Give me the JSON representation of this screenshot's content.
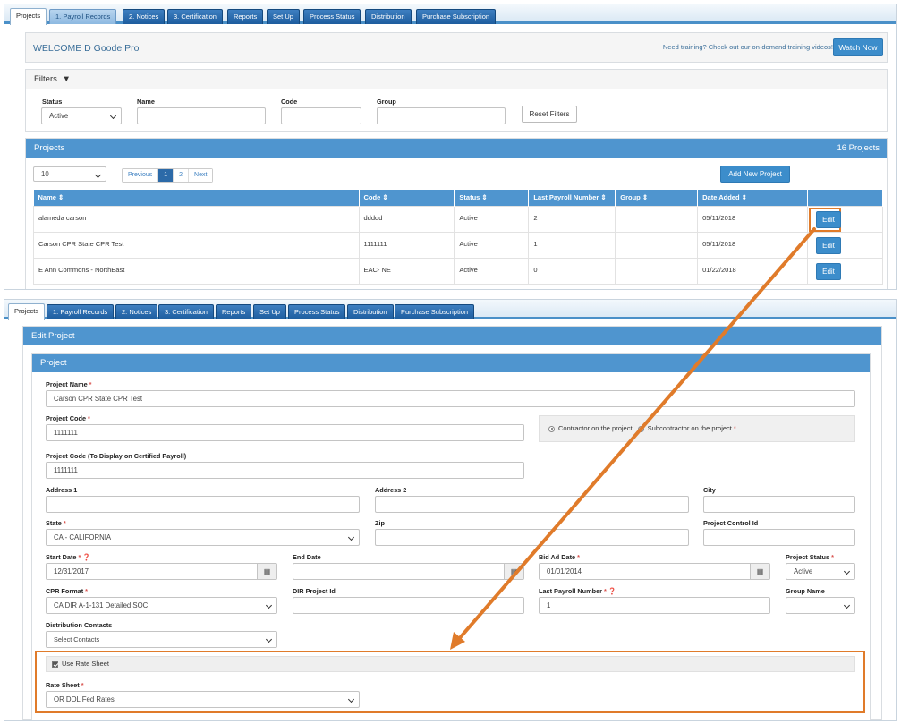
{
  "tabs": [
    "Projects",
    "1. Payroll Records",
    "2. Notices",
    "3. Certification",
    "Reports",
    "Set Up",
    "Process Status",
    "Distribution",
    "Purchase Subscription"
  ],
  "welcome": {
    "text": "WELCOME D Goode Pro",
    "training_text": "Need training? Check out our on-demand training videos!",
    "watch_button": "Watch Now"
  },
  "filters": {
    "title": "Filters",
    "status_label": "Status",
    "status_value": "Active",
    "name_label": "Name",
    "code_label": "Code",
    "group_label": "Group",
    "reset_button": "Reset Filters"
  },
  "projects": {
    "title": "Projects",
    "count": "16 Projects",
    "page_size": "10",
    "pager": {
      "previous": "Previous",
      "page1": "1",
      "page2": "2",
      "next": "Next"
    },
    "add_button": "Add New Project",
    "columns": [
      "Name ⇕",
      "Code ⇕",
      "Status ⇕",
      "Last Payroll Number ⇕",
      "Group ⇕",
      "Date Added ⇕"
    ],
    "rows": [
      {
        "name": "alameda carson",
        "code": "ddddd",
        "status": "Active",
        "last_payroll": "2",
        "group": "",
        "date": "05/11/2018",
        "edit": "Edit"
      },
      {
        "name": "Carson CPR State CPR Test",
        "code": "1111111",
        "status": "Active",
        "last_payroll": "1",
        "group": "",
        "date": "05/11/2018",
        "edit": "Edit"
      },
      {
        "name": "E Ann Commons - NorthEast",
        "code": "EAC- NE",
        "status": "Active",
        "last_payroll": "0",
        "group": "",
        "date": "01/22/2018",
        "edit": "Edit"
      }
    ]
  },
  "edit": {
    "title": "Edit Project",
    "section": "Project",
    "project_name_label": "Project Name",
    "project_name": "Carson CPR State CPR Test",
    "project_code_label": "Project Code",
    "project_code": "1111111",
    "contractor_label": "Contractor on the project",
    "subcontractor_label": "Subcontractor on the project",
    "display_code_label": "Project Code (To Display on Certified Payroll)",
    "display_code": "1111111",
    "address1_label": "Address 1",
    "address2_label": "Address 2",
    "city_label": "City",
    "state_label": "State",
    "state_value": "CA - CALIFORNIA",
    "zip_label": "Zip",
    "control_id_label": "Project Control Id",
    "start_date_label": "Start Date",
    "start_date": "12/31/2017",
    "end_date_label": "End Date",
    "bid_date_label": "Bid Ad Date",
    "bid_date": "01/01/2014",
    "project_status_label": "Project Status",
    "project_status": "Active",
    "cpr_format_label": "CPR Format",
    "cpr_format": "CA DIR A-1-131 Detailed SOC",
    "dir_id_label": "DIR Project Id",
    "last_payroll_label": "Last Payroll Number",
    "last_payroll": "1",
    "group_name_label": "Group Name",
    "distribution_label": "Distribution Contacts",
    "distribution_value": "Select Contacts",
    "use_rate_sheet_label": "Use Rate Sheet",
    "rate_sheet_label": "Rate Sheet",
    "rate_sheet_value": "OR DOL Fed Rates"
  },
  "colors": {
    "accent": "#4f95cf",
    "highlight": "#e07b2a",
    "tab": "#2c6aa8"
  }
}
